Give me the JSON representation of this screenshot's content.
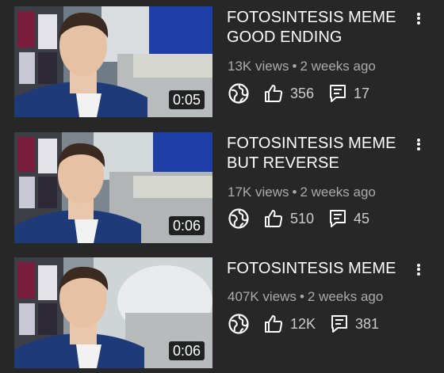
{
  "videos": [
    {
      "title": "FOTOSINTESIS MEME\nGOOD ENDING",
      "views": "13K views",
      "age": "2 weeks ago",
      "duration": "0:05",
      "likes": "356",
      "comments": "17"
    },
    {
      "title": "FOTOSINTESIS MEME\nBUT REVERSE",
      "views": "17K views",
      "age": "2 weeks ago",
      "duration": "0:06",
      "likes": "510",
      "comments": "45"
    },
    {
      "title": "FOTOSINTESIS MEME",
      "views": "407K views",
      "age": "2 weeks ago",
      "duration": "0:06",
      "likes": "12K",
      "comments": "381"
    }
  ],
  "meta_separator": "•",
  "icons": {
    "visibility": "globe-icon",
    "like": "thumbs-up-icon",
    "comment": "comment-icon",
    "menu": "more-vertical-icon"
  },
  "colors": {
    "background": "#272727",
    "title": "#ffffff",
    "meta": "#aaaaaa",
    "duration_bg": "#000000"
  }
}
